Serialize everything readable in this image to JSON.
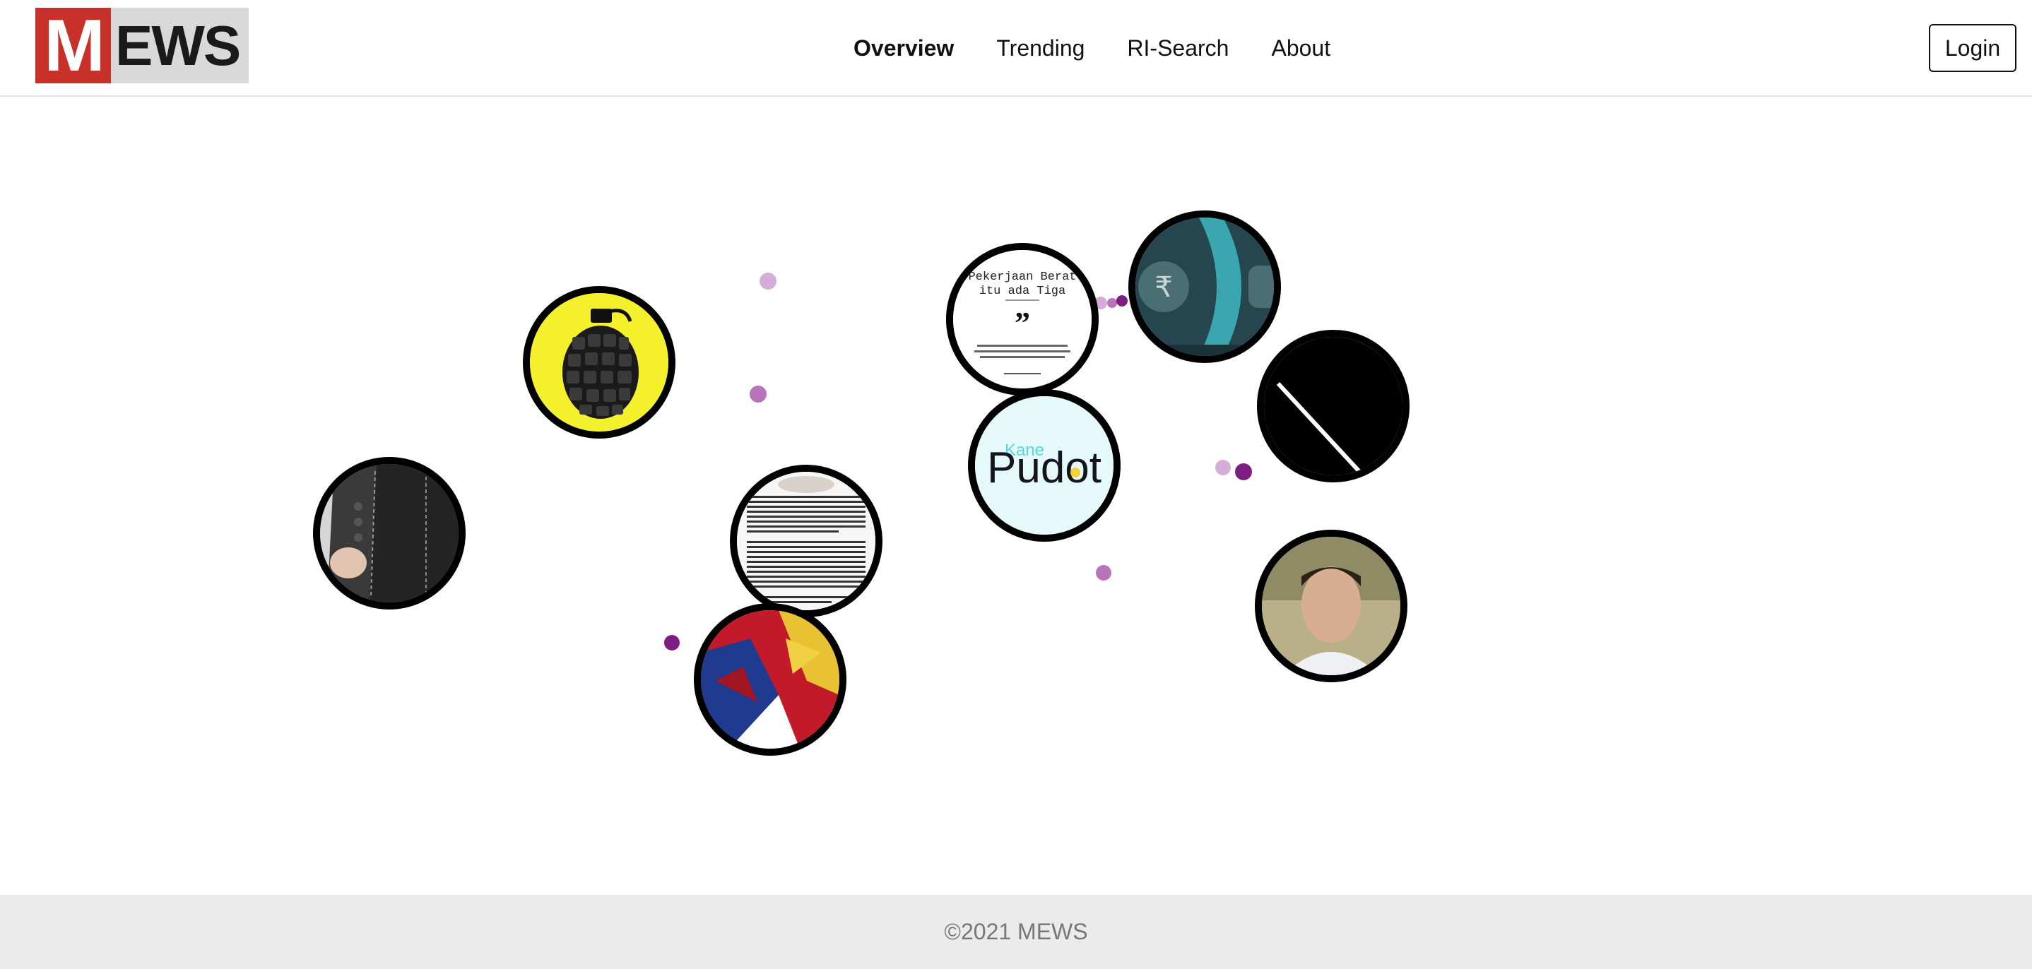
{
  "brand": {
    "logo_initial": "M",
    "logo_rest": "EWS",
    "logo_red": "#c7312a",
    "logo_gray": "#d9d9d9"
  },
  "nav": {
    "items": [
      {
        "label": "Overview",
        "active": true
      },
      {
        "label": "Trending",
        "active": false
      },
      {
        "label": "RI-Search",
        "active": false
      },
      {
        "label": "About",
        "active": false
      }
    ]
  },
  "login_label": "Login",
  "graph": {
    "dot_colors": {
      "light": "#d4aed6",
      "medium": "#b774bb",
      "dark": "#7e1e82"
    },
    "nodes": [
      {
        "id": "grenade",
        "icon": "grenade-icon"
      },
      {
        "id": "jacket",
        "icon": "jacket-photo"
      },
      {
        "id": "article",
        "icon": "article-text-image"
      },
      {
        "id": "flag",
        "icon": "flag-image"
      },
      {
        "id": "quote",
        "title_line1": "Pekerjaan Berat",
        "title_line2": "itu ada Tiga",
        "mark": "”"
      },
      {
        "id": "pudot",
        "small": "Kane",
        "big": "Pudot"
      },
      {
        "id": "rupee",
        "symbol": "₹"
      },
      {
        "id": "black-slash",
        "icon": "slash-icon"
      },
      {
        "id": "portrait",
        "icon": "person-photo"
      }
    ]
  },
  "footer": {
    "copyright": "©2021 MEWS"
  }
}
